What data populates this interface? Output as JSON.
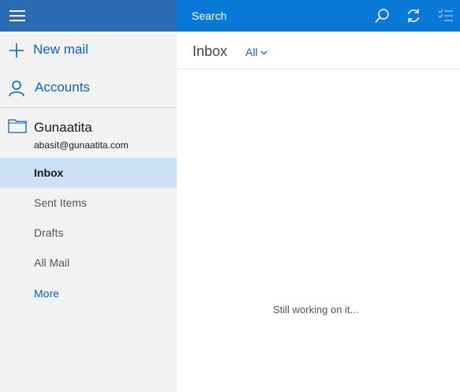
{
  "topbar": {
    "search_placeholder": "Search"
  },
  "nav": {
    "new_mail_label": "New mail",
    "accounts_label": "Accounts"
  },
  "account": {
    "name": "Gunaatita",
    "email": "abasit@gunaatita.com"
  },
  "folders": [
    {
      "label": "Inbox",
      "selected": true
    },
    {
      "label": "Sent Items",
      "selected": false
    },
    {
      "label": "Drafts",
      "selected": false
    },
    {
      "label": "All Mail",
      "selected": false
    },
    {
      "label": "More",
      "selected": false
    }
  ],
  "main": {
    "title": "Inbox",
    "filter_label": "All",
    "status_text": "Still working on it..."
  },
  "colors": {
    "sidebar_header": "#2b6bb5",
    "topbar": "#0a78d7",
    "accent": "#0e62b8",
    "selected_bg": "#cce1f5",
    "sidebar_bg": "#f2f2f2"
  },
  "icons": [
    "hamburger-icon",
    "search-icon",
    "sync-icon",
    "select-mode-icon",
    "plus-icon",
    "person-icon",
    "folder-icon",
    "chevron-down-icon"
  ]
}
